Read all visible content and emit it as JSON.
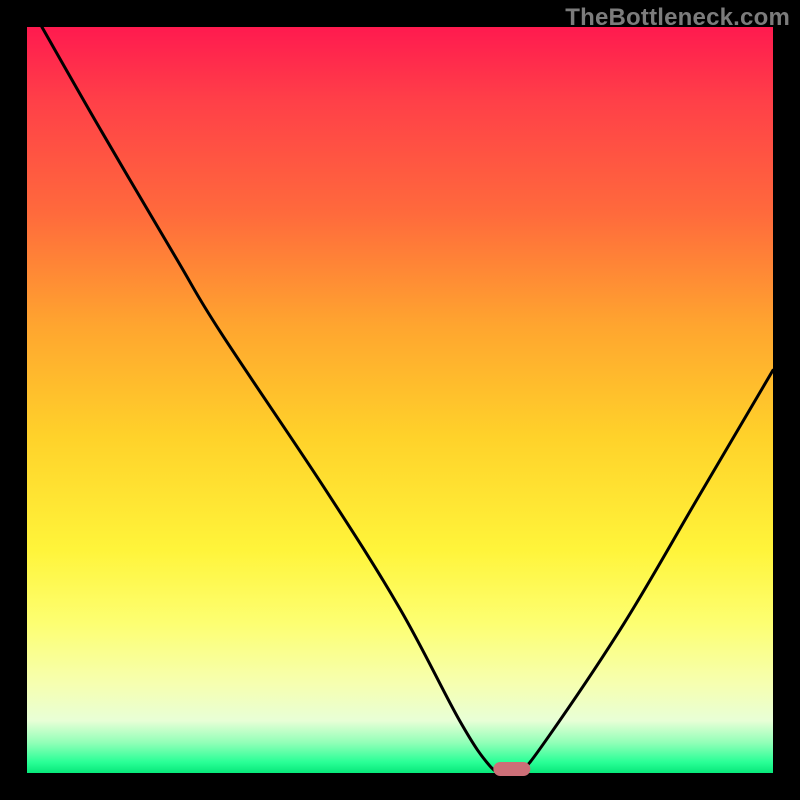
{
  "watermark": "TheBottleneck.com",
  "chart_data": {
    "type": "line",
    "title": "",
    "xlabel": "",
    "ylabel": "",
    "xlim": [
      0,
      100
    ],
    "ylim": [
      0,
      100
    ],
    "x": [
      2,
      10,
      20,
      26,
      40,
      50,
      58,
      62,
      64,
      66,
      70,
      80,
      90,
      100
    ],
    "values": [
      100,
      86,
      69,
      59,
      38,
      22,
      7,
      1,
      0,
      0,
      5,
      20,
      37,
      54
    ],
    "marker": {
      "center_x": 65,
      "y": 0,
      "width_x": 5,
      "color": "#cc6e77"
    }
  },
  "gradient_stops": [
    {
      "pct": 0,
      "color": "#ff1a4f"
    },
    {
      "pct": 10,
      "color": "#ff4048"
    },
    {
      "pct": 25,
      "color": "#ff6a3c"
    },
    {
      "pct": 40,
      "color": "#ffa52f"
    },
    {
      "pct": 55,
      "color": "#ffd22a"
    },
    {
      "pct": 70,
      "color": "#fff43a"
    },
    {
      "pct": 80,
      "color": "#fdff72"
    },
    {
      "pct": 88,
      "color": "#f6ffb0"
    },
    {
      "pct": 93,
      "color": "#e8ffd6"
    },
    {
      "pct": 96,
      "color": "#8fffb7"
    },
    {
      "pct": 98.5,
      "color": "#2bff97"
    },
    {
      "pct": 100,
      "color": "#07e87a"
    }
  ]
}
